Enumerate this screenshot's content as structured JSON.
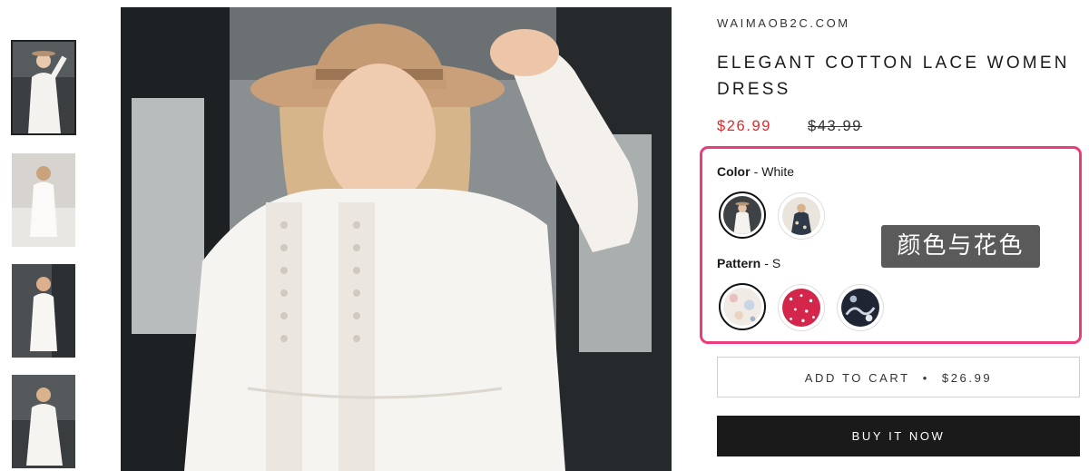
{
  "store": {
    "vendor": "WAIMAOB2C.COM"
  },
  "product": {
    "title": "ELEGANT COTTON LACE WOMEN DRESS",
    "price": "$26.99",
    "compare_at_price": "$43.99"
  },
  "gallery": {
    "thumbnails": [
      "thumbnail-1",
      "thumbnail-2",
      "thumbnail-3",
      "thumbnail-4"
    ],
    "active_index": 0
  },
  "options": {
    "color": {
      "label": "Color",
      "separator": "-",
      "selected": "White",
      "swatches": [
        "white-dress",
        "floral-dress"
      ]
    },
    "pattern": {
      "label": "Pattern",
      "separator": "-",
      "selected": "S",
      "swatches": [
        "light-floral",
        "red-floral",
        "dark-floral"
      ]
    }
  },
  "annotation": {
    "text": "颜色与花色",
    "highlight_color": "#ec3c7c"
  },
  "buttons": {
    "add_to_cart": "ADD TO CART",
    "add_to_cart_separator": "•",
    "add_to_cart_price": "$26.99",
    "buy_now": "BUY IT NOW"
  },
  "colors": {
    "sale_price": "#e02a2a",
    "buy_button": "#1a1a1a"
  }
}
